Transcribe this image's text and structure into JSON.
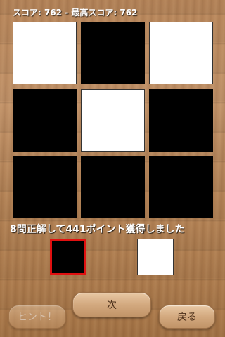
{
  "header": {
    "score_text": "スコア: 762 - 最高スコア: 762"
  },
  "grid": {
    "cells": [
      {
        "color": "white"
      },
      {
        "color": "black"
      },
      {
        "color": "white"
      },
      {
        "color": "black"
      },
      {
        "color": "white"
      },
      {
        "color": "black"
      },
      {
        "color": "black"
      },
      {
        "color": "black"
      },
      {
        "color": "black"
      }
    ]
  },
  "result": {
    "message": "8問正解して441ポイント獲得しました"
  },
  "answers": [
    {
      "color": "black",
      "selected": true,
      "highlight": "#e01010"
    },
    {
      "color": "white",
      "selected": false
    }
  ],
  "buttons": {
    "hint_label": "ヒント！",
    "next_label": "次",
    "back_label": "戻る"
  }
}
